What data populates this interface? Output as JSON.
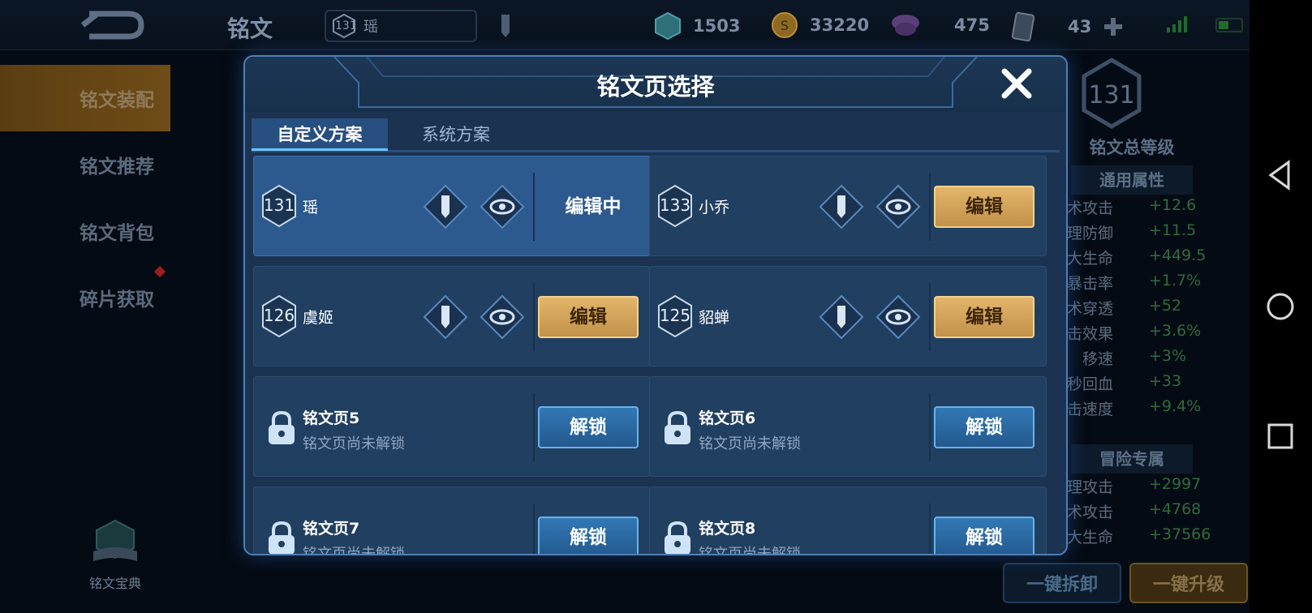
{
  "topbar": {
    "title": "铭文",
    "hero_level": "131",
    "hero_name": "瑶",
    "currencies": [
      {
        "icon": "diamond-icon",
        "value": "1503"
      },
      {
        "icon": "gold-coin-icon",
        "value": "33220"
      },
      {
        "icon": "crystal-icon",
        "value": "475"
      },
      {
        "icon": "card-icon",
        "value": "43"
      }
    ]
  },
  "sidebar": {
    "items": [
      {
        "label": "铭文装配",
        "active": true
      },
      {
        "label": "铭文推荐",
        "active": false
      },
      {
        "label": "铭文背包",
        "active": false
      },
      {
        "label": "碎片获取",
        "active": false
      }
    ],
    "codex_label": "铭文宝典"
  },
  "stats_panel": {
    "level": "131",
    "level_label": "铭文总等级",
    "general_header": "通用属性",
    "general_stats": [
      {
        "name": "术攻击",
        "value": "+12.6"
      },
      {
        "name": "理防御",
        "value": "+11.5"
      },
      {
        "name": "大生命",
        "value": "+449.5"
      },
      {
        "name": "暴击率",
        "value": "+1.7%"
      },
      {
        "name": "术穿透",
        "value": "+52"
      },
      {
        "name": "击效果",
        "value": "+3.6%"
      },
      {
        "name": "移速",
        "value": "+3%"
      },
      {
        "name": "秒回血",
        "value": "+33"
      },
      {
        "name": "击速度",
        "value": "+9.4%"
      }
    ],
    "adventure_header": "冒险专属",
    "adventure_stats": [
      {
        "name": "理攻击",
        "value": "+2997"
      },
      {
        "name": "术攻击",
        "value": "+4768"
      },
      {
        "name": "大生命",
        "value": "+37566"
      }
    ],
    "btn_unequip": "一键拆卸",
    "btn_upgrade": "一键升级"
  },
  "dialog": {
    "title": "铭文页选择",
    "tabs": [
      {
        "label": "自定义方案",
        "active": true
      },
      {
        "label": "系统方案",
        "active": false
      }
    ],
    "pages": [
      {
        "level": "131",
        "name": "瑶",
        "status": "编辑中"
      },
      {
        "level": "133",
        "name": "小乔",
        "button": "编辑"
      },
      {
        "level": "126",
        "name": "虞姬",
        "button": "编辑"
      },
      {
        "level": "125",
        "name": "貂蝉",
        "button": "编辑"
      },
      {
        "name": "铭文页5",
        "sub": "铭文页尚未解锁",
        "button": "解锁"
      },
      {
        "name": "铭文页6",
        "sub": "铭文页尚未解锁",
        "button": "解锁"
      },
      {
        "name": "铭文页7",
        "sub": "铭文页尚未解锁",
        "button": "解锁"
      },
      {
        "name": "铭文页8",
        "sub": "铭文页尚未解锁",
        "button": "解锁"
      }
    ]
  }
}
